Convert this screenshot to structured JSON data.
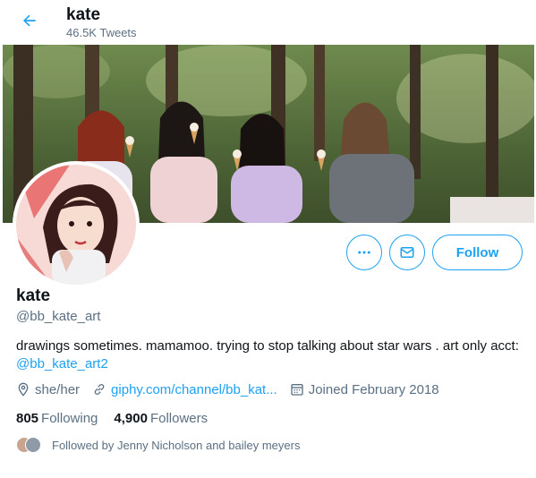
{
  "header": {
    "name": "kate",
    "tweet_count": "46.5K Tweets"
  },
  "profile": {
    "display_name": "kate",
    "handle": "@bb_kate_art",
    "bio_text": "drawings sometimes. mamamoo. trying to stop talking about star wars . art only acct: ",
    "bio_link": "@bb_kate_art2",
    "pronouns": "she/her",
    "website": "giphy.com/channel/bb_kat...",
    "joined": "Joined February 2018"
  },
  "actions": {
    "follow_label": "Follow"
  },
  "stats": {
    "following_count": "805",
    "following_label": "Following",
    "followers_count": "4,900",
    "followers_label": "Followers"
  },
  "followed_by": "Followed by Jenny Nicholson and bailey meyers",
  "colors": {
    "accent": "#1da1f2",
    "secondary_text": "#5b7083"
  }
}
